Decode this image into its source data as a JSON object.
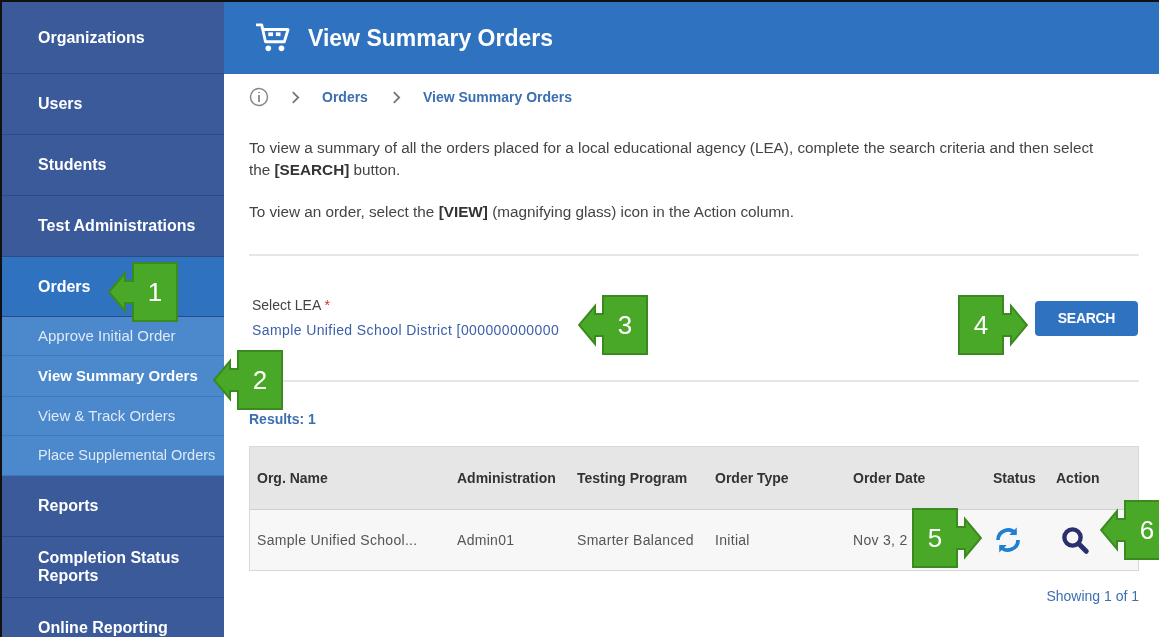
{
  "sidebar": {
    "items": [
      {
        "label": "Organizations",
        "selected": false,
        "kind": "main"
      },
      {
        "label": "Users",
        "selected": false,
        "kind": "main"
      },
      {
        "label": "Students",
        "selected": false,
        "kind": "main"
      },
      {
        "label": "Test Administrations",
        "selected": false,
        "kind": "main"
      },
      {
        "label": "Orders",
        "selected": true,
        "kind": "main"
      },
      {
        "label": "Approve Initial Order",
        "selected": false,
        "kind": "sub"
      },
      {
        "label": "View Summary Orders",
        "selected": true,
        "kind": "sub"
      },
      {
        "label": "View & Track Orders",
        "selected": false,
        "kind": "sub"
      },
      {
        "label": "Place Supplemental Orders",
        "selected": false,
        "kind": "sub"
      },
      {
        "label": "Reports",
        "selected": false,
        "kind": "main"
      },
      {
        "label": "Completion Status Reports",
        "selected": false,
        "kind": "main"
      },
      {
        "label": "Online Reporting",
        "selected": false,
        "kind": "main"
      }
    ]
  },
  "header": {
    "title": "View Summary Orders"
  },
  "breadcrumb": [
    "Orders",
    "View Summary Orders"
  ],
  "instructions": [
    "To view a summary of all the orders placed for a local educational agency (LEA), complete the search criteria and then select the **[SEARCH]** button.",
    "To view an order, select the **[VIEW]** (magnifying glass) icon in the Action column."
  ],
  "lea": {
    "label": "Select LEA",
    "required_mark": "*",
    "value": "Sample Unified School District [000000000000"
  },
  "search_button": "SEARCH",
  "results_label": "Results: 1",
  "table": {
    "columns": [
      "Org. Name",
      "Administration",
      "Testing Program",
      "Order Type",
      "Order Date",
      "Status",
      "Action"
    ],
    "rows": [
      {
        "cells": [
          "Sample Unified School...",
          "Admin01",
          "Smarter Balanced",
          "Initial",
          "Nov 3, 2"
        ]
      }
    ]
  },
  "pagination": "Showing 1 of 1",
  "callouts": [
    {
      "number": "1",
      "kind": "left"
    },
    {
      "number": "2",
      "kind": "left"
    },
    {
      "number": "3",
      "kind": "left"
    },
    {
      "number": "4",
      "kind": "right"
    },
    {
      "number": "5",
      "kind": "right"
    },
    {
      "number": "6",
      "kind": "left"
    }
  ]
}
